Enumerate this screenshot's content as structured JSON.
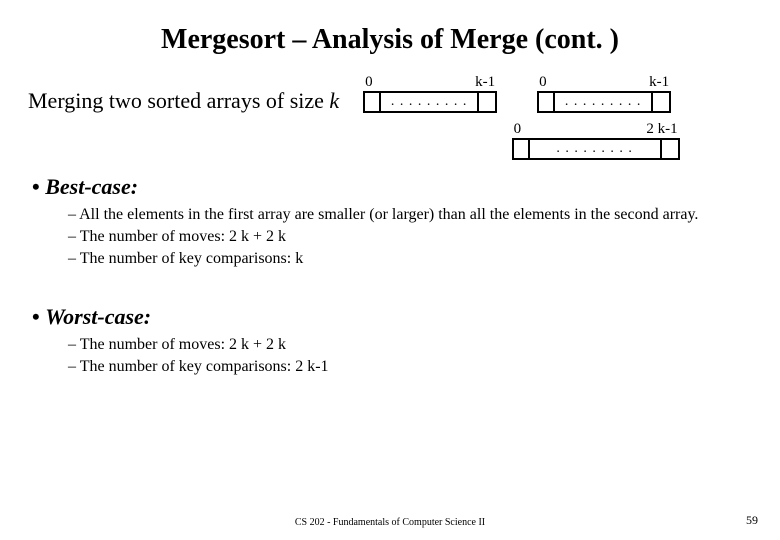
{
  "title": "Mergesort – Analysis of Merge (cont. )",
  "merging": {
    "prefix": "Merging two sorted arrays of size ",
    "var": "k"
  },
  "arrays": {
    "top": [
      {
        "left": "0",
        "right": "k-1",
        "dots": ". . . . . . . . ."
      },
      {
        "left": "0",
        "right": "k-1",
        "dots": ". . . . . . . . ."
      }
    ],
    "output": {
      "left": "0",
      "right": "2 k-1",
      "dots": ". . . . . . . . ."
    }
  },
  "best": {
    "heading": "Best-case:",
    "items": [
      "All the elements in the first array are smaller (or larger) than all the elements in the second array.",
      "The number of moves: 2 k + 2 k",
      "The number of key comparisons: k"
    ]
  },
  "worst": {
    "heading": "Worst-case:",
    "items": [
      "The number of moves: 2 k + 2 k",
      "The number of key comparisons: 2 k-1"
    ]
  },
  "footer": "CS 202 - Fundamentals of Computer Science II",
  "page": "59"
}
